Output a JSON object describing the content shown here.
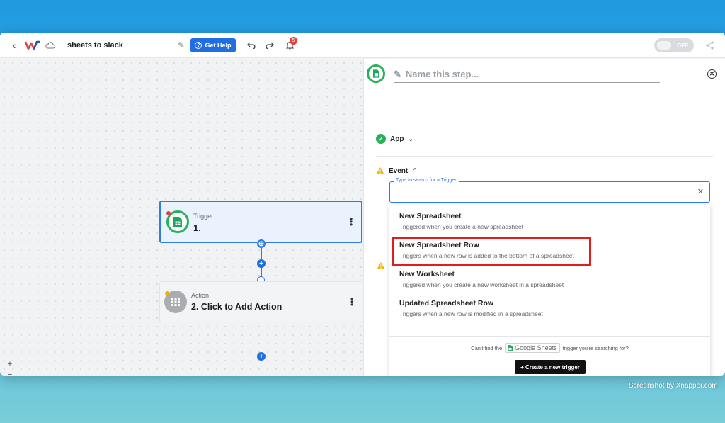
{
  "header": {
    "workflow_title": "sheets to slack",
    "help_label": "Get Help",
    "notification_count": "5",
    "toggle_label": "OFF"
  },
  "canvas": {
    "trigger": {
      "type": "Trigger",
      "name": "1."
    },
    "action": {
      "type": "Action",
      "name": "2. Click to Add Action"
    },
    "zoom_controls": [
      "+",
      "−",
      "⛶",
      "🔒"
    ]
  },
  "panel": {
    "step_name_placeholder": "Name this step...",
    "app_label": "App",
    "event_label": "Event",
    "search": {
      "label": "Type to search for a Trigger",
      "value": ""
    },
    "options": [
      {
        "title": "New Spreadsheet",
        "desc": "Triggered when you create a new spreadsheet"
      },
      {
        "title": "New Spreadsheet Row",
        "desc": "Triggers when a new row is added to the bottom of a spreadsheet"
      },
      {
        "title": "New Worksheet",
        "desc": "Triggered when you create a new worksheet in a spreadsheet"
      },
      {
        "title": "Updated Spreadsheet Row",
        "desc": "Triggers when a new row is modified in a spreadsheet"
      }
    ],
    "footer": {
      "prefix": "Can't find the",
      "app_name": "Google Sheets",
      "suffix": "trigger you're searching for?",
      "create_label": "+ Create a new trigger"
    }
  },
  "watermark": "Screenshot by Xnapper.com",
  "colors": {
    "accent": "#1f6fe0",
    "success": "#28b05a",
    "warning": "#f0b400",
    "highlight": "#e11d1d"
  }
}
